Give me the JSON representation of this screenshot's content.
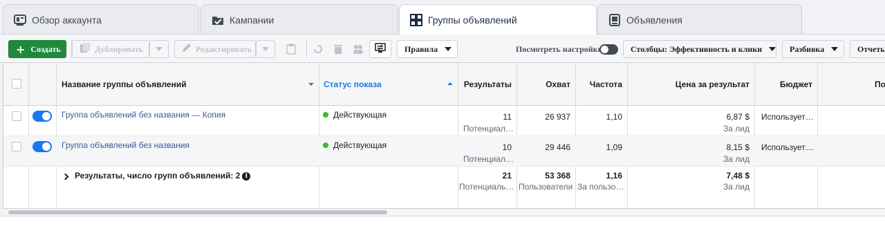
{
  "tabs": [
    {
      "label": "Обзор аккаунта",
      "icon": "account-overview-icon"
    },
    {
      "label": "Кампании",
      "icon": "campaign-folder-icon"
    },
    {
      "label": "Группы объявлений",
      "icon": "ad-sets-grid-icon"
    },
    {
      "label": "Объявления",
      "icon": "ads-icon"
    }
  ],
  "toolbar": {
    "create": "Создать",
    "duplicate": "Дублировать",
    "edit": "Редактировать",
    "rules": "Правила",
    "view_settings": "Посмотреть настройки",
    "columns": "Столбцы: Эффективность и клики",
    "breakdown": "Разбивка",
    "reports": "Отчеты"
  },
  "table": {
    "headers": {
      "name": "Название группы объявлений",
      "status": "Статус показа",
      "results": "Результаты",
      "reach": "Охват",
      "frequency": "Частота",
      "cost": "Цена за результат",
      "budget": "Бюджет",
      "spent": "Пот"
    },
    "rows": [
      {
        "name": "Группа объявлений без названия — Копия",
        "status": "Действующая",
        "results": "11",
        "results_sub": "Потенциал…",
        "reach": "26 937",
        "frequency": "1,10",
        "cost": "6,87 $",
        "cost_sub": "За лид",
        "budget": "Использует…"
      },
      {
        "name": "Группа объявлений без названия",
        "status": "Действующая",
        "results": "10",
        "results_sub": "Потенциал…",
        "reach": "29 446",
        "frequency": "1,09",
        "cost": "8,15 $",
        "cost_sub": "За лид",
        "budget": "Использует…"
      }
    ],
    "summary": {
      "label": "Результаты, число групп объявлений: 2",
      "results": "21",
      "results_sub": "Потенциаль…",
      "reach": "53 368",
      "reach_sub": "Пользователи",
      "frequency": "1,16",
      "frequency_sub": "За пользо…",
      "cost": "7,48 $",
      "cost_sub": "За лид"
    }
  },
  "colors": {
    "accent": "#1877f2",
    "create_button": "#1f8a3b",
    "active_dot": "#42b72a",
    "link": "#385898"
  }
}
